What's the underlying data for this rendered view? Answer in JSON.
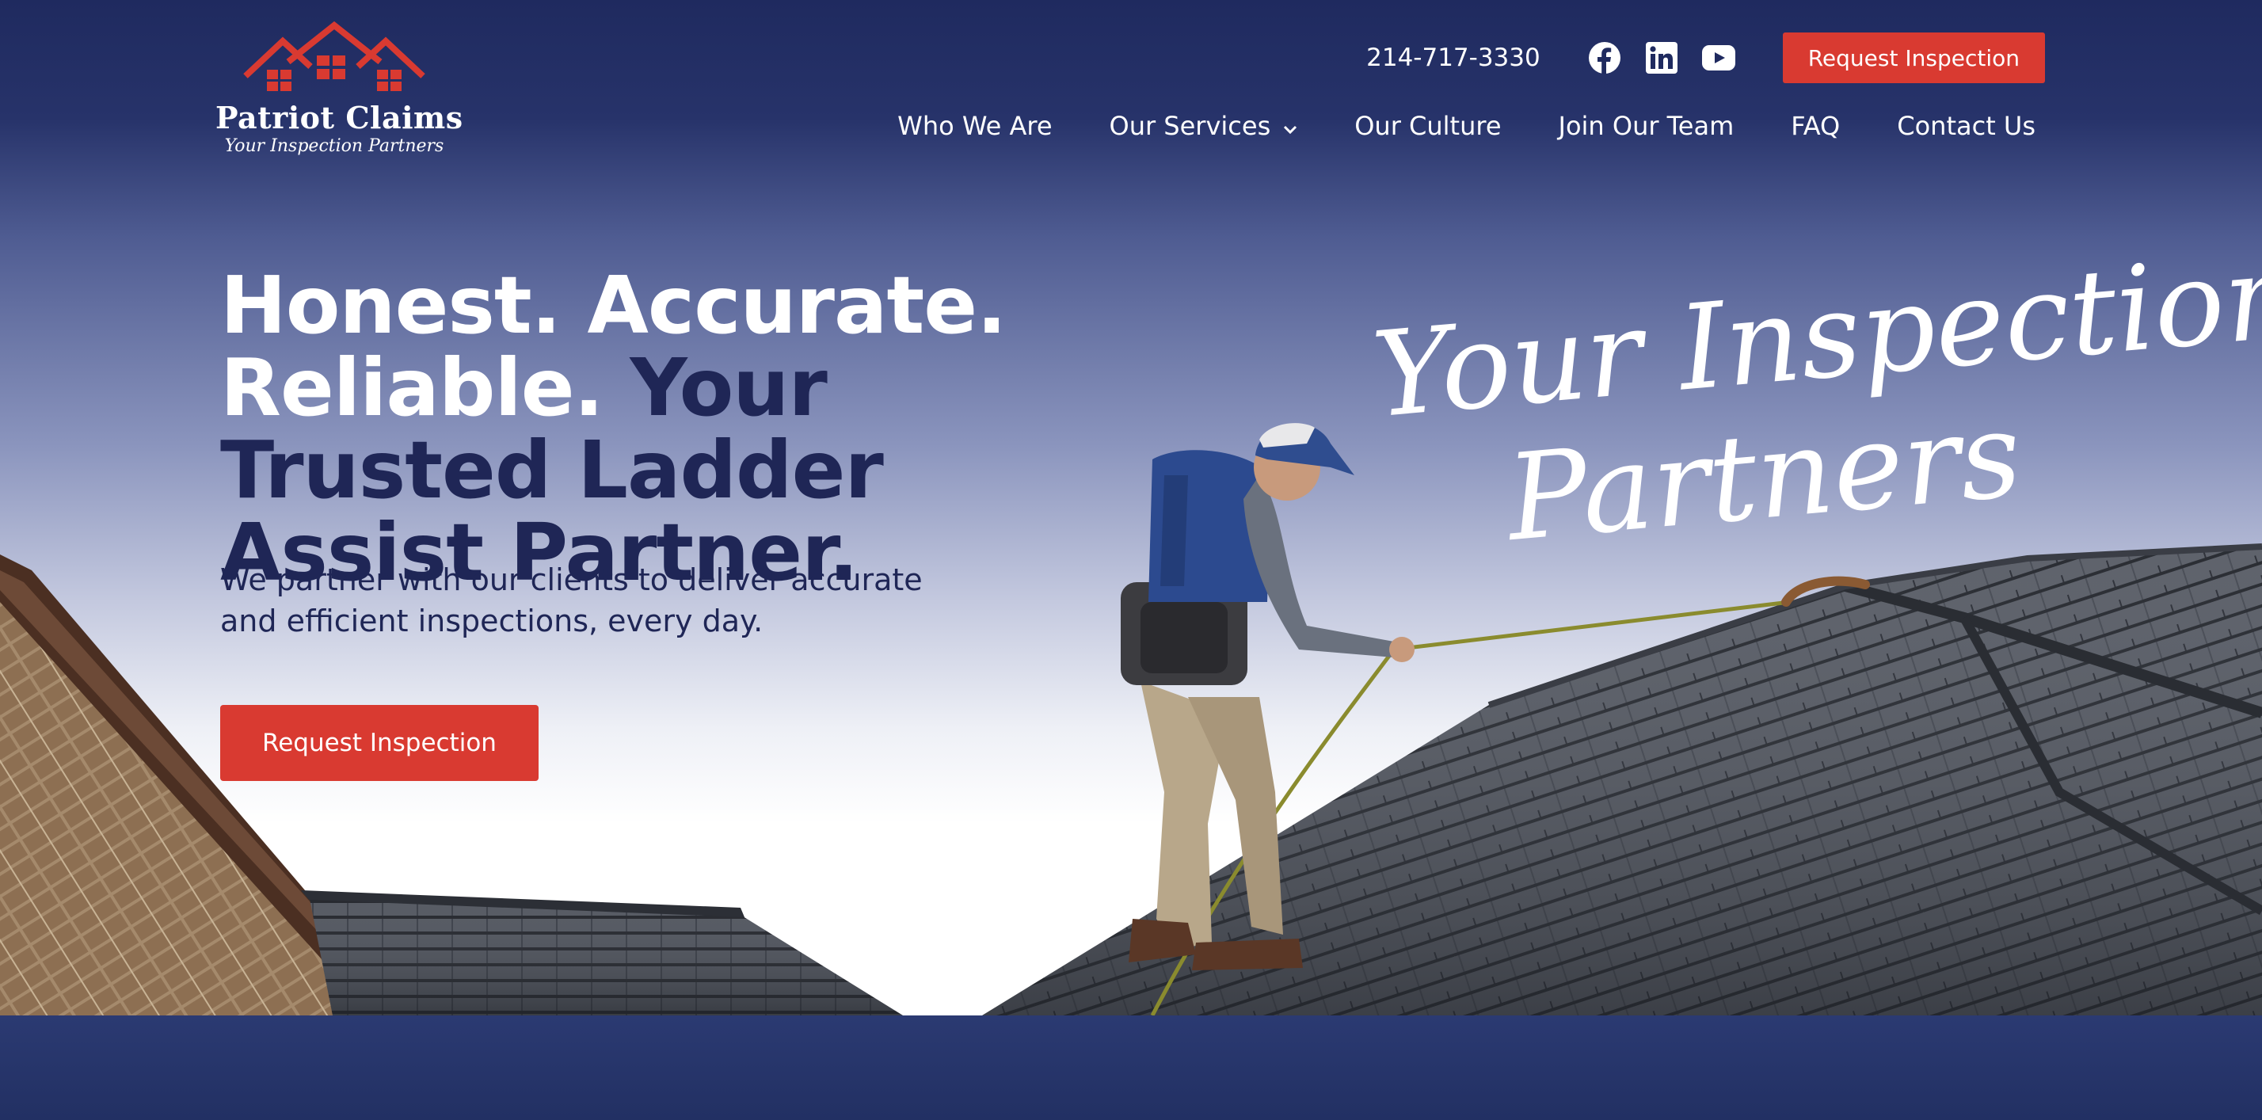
{
  "header": {
    "logo": {
      "name": "Patriot Claims",
      "tagline": "Your Inspection Partners",
      "icon": "houses-logo-icon",
      "brand_color": "#d93a31"
    },
    "phone": "214-717-3330",
    "social": [
      {
        "icon": "facebook-icon",
        "label": "Facebook"
      },
      {
        "icon": "linkedin-icon",
        "label": "LinkedIn"
      },
      {
        "icon": "youtube-icon",
        "label": "YouTube"
      }
    ],
    "cta_label": "Request Inspection",
    "nav": [
      {
        "label": "Who We Are"
      },
      {
        "label": "Our Services",
        "has_dropdown": true,
        "icon": "chevron-down-icon"
      },
      {
        "label": "Our Culture"
      },
      {
        "label": "Join Our Team"
      },
      {
        "label": "FAQ"
      },
      {
        "label": "Contact Us"
      }
    ]
  },
  "hero": {
    "headline_white": "Honest. Accurate. Reliable.",
    "headline_navy": "Your Trusted Ladder Assist Partner.",
    "subtext": "We partner with our clients to deliver accurate and efficient inspections, every day.",
    "cta_label": "Request Inspection",
    "script_line1": "Your Inspection",
    "script_line2": "Partners",
    "image": "roof-inspector-photo"
  },
  "colors": {
    "navy": "#1f2656",
    "header_bg": "#1f2a5f",
    "accent_red": "#d93a31",
    "band": "#263467"
  }
}
